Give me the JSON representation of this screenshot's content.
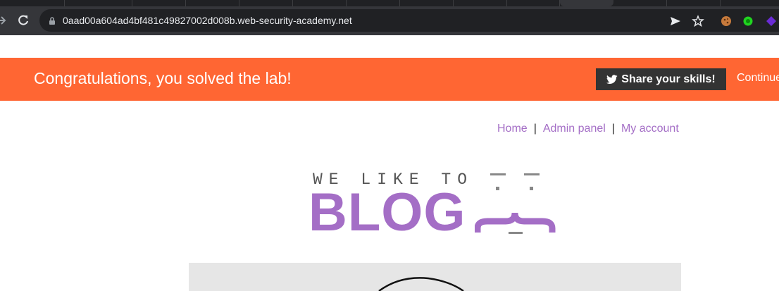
{
  "browser": {
    "url": "0aad00a604ad4bf481c49827002d008b.web-security-academy.net"
  },
  "banner": {
    "title": "Congratulations, you solved the lab!",
    "share_label": "Share your skills!",
    "continue_label": "Continue"
  },
  "nav": {
    "home": "Home",
    "admin": "Admin panel",
    "account": "My account",
    "separator": "|"
  },
  "logo": {
    "small_text": "WE LIKE TO",
    "big_text": "BLOG"
  },
  "colors": {
    "banner": "#ff6633",
    "accent": "#a46ec6"
  }
}
